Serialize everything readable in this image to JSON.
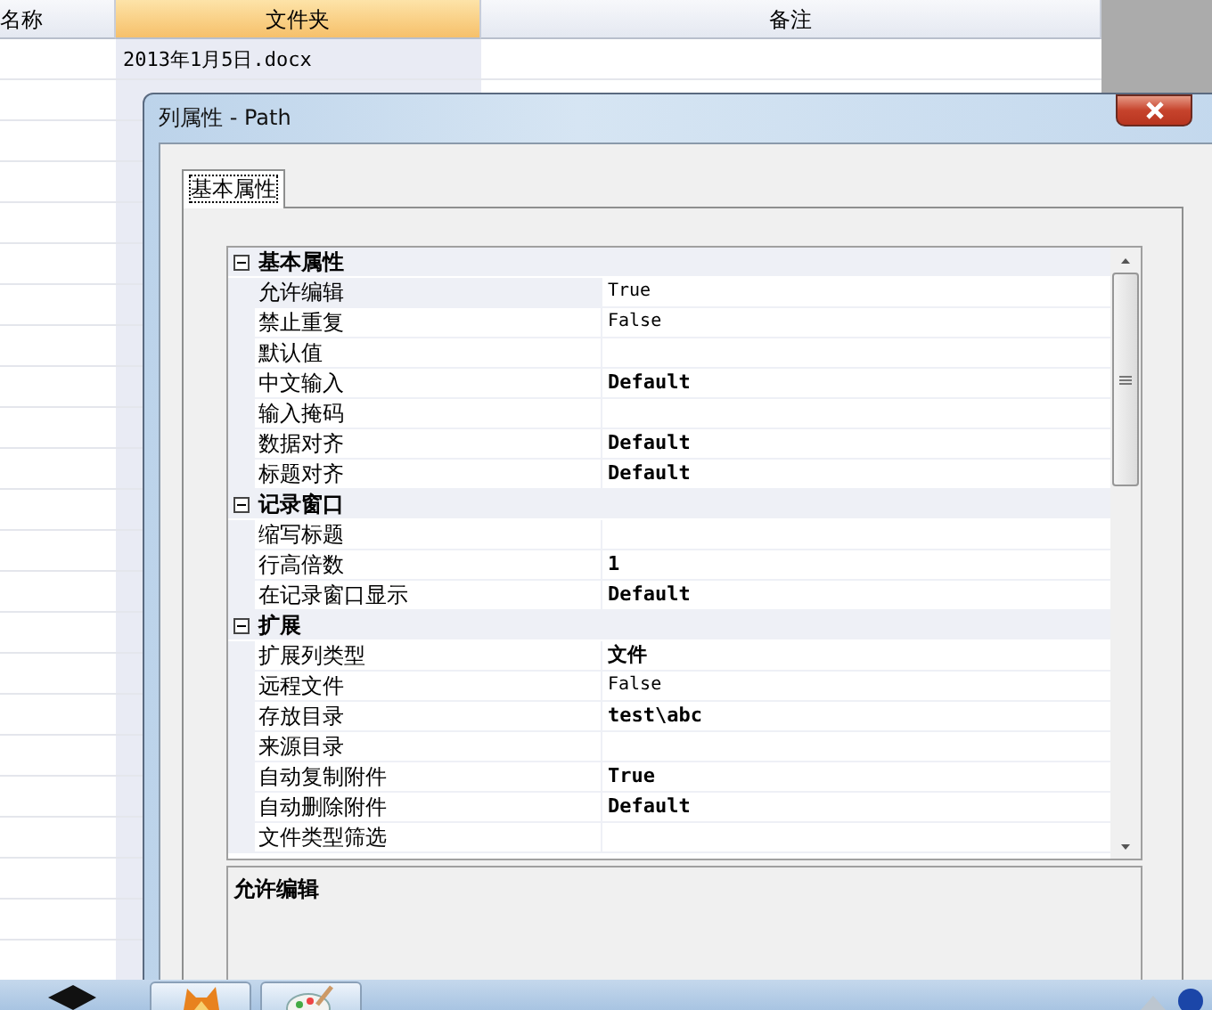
{
  "background_table": {
    "columns": [
      {
        "label": "名称",
        "selected": false
      },
      {
        "label": "文件夹",
        "selected": true
      },
      {
        "label": "备注",
        "selected": false
      }
    ],
    "rows": [
      {
        "folder": "2013年1月5日.docx"
      }
    ]
  },
  "dialog": {
    "title": "列属性 - Path",
    "tabs": [
      {
        "label": "基本属性",
        "selected": true
      }
    ],
    "categories": [
      {
        "name": "基本属性",
        "expanded": true,
        "properties": [
          {
            "name": "允许编辑",
            "value": "True",
            "bold": false,
            "selected": true
          },
          {
            "name": "禁止重复",
            "value": "False",
            "bold": false,
            "selected": false
          },
          {
            "name": "默认值",
            "bold": false,
            "selected": false
          },
          {
            "name": "中文输入",
            "value": "Default",
            "bold": true,
            "selected": false
          },
          {
            "name": "输入掩码",
            "bold": false,
            "selected": false
          },
          {
            "name": "数据对齐",
            "value": "Default",
            "bold": true,
            "selected": false
          },
          {
            "name": "标题对齐",
            "value": "Default",
            "bold": true,
            "selected": false
          }
        ]
      },
      {
        "name": "记录窗口",
        "expanded": true,
        "properties": [
          {
            "name": "缩写标题",
            "bold": false,
            "selected": false
          },
          {
            "name": "行高倍数",
            "value": "1",
            "bold": true,
            "selected": false
          },
          {
            "name": "在记录窗口显示",
            "value": "Default",
            "bold": true,
            "selected": false
          }
        ]
      },
      {
        "name": "扩展",
        "expanded": true,
        "properties": [
          {
            "name": "扩展列类型",
            "value": "文件",
            "bold": true,
            "selected": false
          },
          {
            "name": "远程文件",
            "value": "False",
            "bold": false,
            "selected": false
          },
          {
            "name": "存放目录",
            "value": "test\\abc",
            "bold": true,
            "selected": false
          },
          {
            "name": "来源目录",
            "bold": false,
            "selected": false
          },
          {
            "name": "自动复制附件",
            "value": "True",
            "bold": true,
            "selected": false
          },
          {
            "name": "自动删除附件",
            "value": "Default",
            "bold": true,
            "selected": false
          },
          {
            "name": "文件类型筛选",
            "bold": false,
            "selected": false
          }
        ]
      }
    ],
    "description": "允许编辑"
  }
}
